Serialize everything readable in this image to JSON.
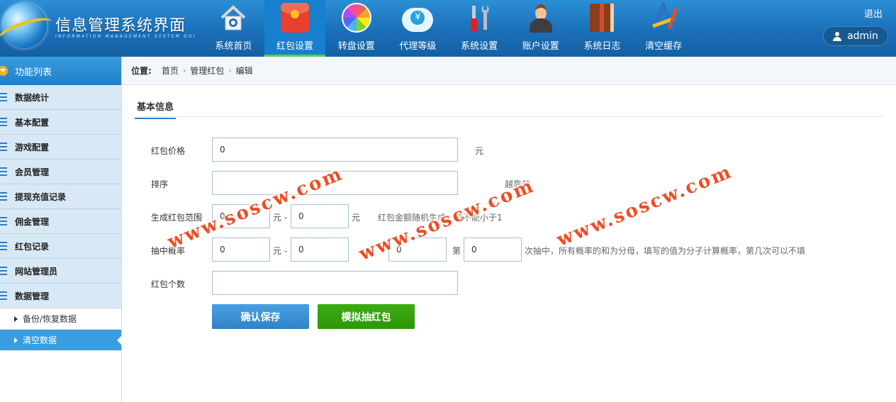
{
  "header": {
    "title": "信息管理系统界面",
    "subtitle": "INFORMATION MANAGEMENT SYSTEM GUI",
    "logout": "退出",
    "user": "admin",
    "nav": [
      {
        "label": "系统首页",
        "icon": "home-icon"
      },
      {
        "label": "红包设置",
        "icon": "red-envelope-icon",
        "active": true
      },
      {
        "label": "转盘设置",
        "icon": "wheel-icon"
      },
      {
        "label": "代理等级",
        "icon": "cloud-money-icon"
      },
      {
        "label": "系统设置",
        "icon": "tools-icon"
      },
      {
        "label": "账户设置",
        "icon": "user-icon"
      },
      {
        "label": "系统日志",
        "icon": "book-icon"
      },
      {
        "label": "清空缓存",
        "icon": "pencil-ruler-icon"
      }
    ]
  },
  "sidebar": {
    "title": "功能列表",
    "items": [
      "数据统计",
      "基本配置",
      "游戏配置",
      "会员管理",
      "提现充值记录",
      "佣金管理",
      "红包记录",
      "网站管理员",
      "数据管理"
    ],
    "subitems": [
      "备份/恢复数据",
      "清空数据"
    ]
  },
  "breadcrumb": {
    "label": "位置:",
    "items": [
      "首页",
      "管理红包",
      "编辑"
    ]
  },
  "form": {
    "section": "基本信息",
    "price_label": "红包价格",
    "price_value": "0",
    "price_unit": "元",
    "sort_label": "排序",
    "sort_value": "",
    "sort_hint": "越靠前",
    "range_label": "生成红包范围",
    "range_min": "0",
    "range_max": "0",
    "range_unit1": "元 -",
    "range_unit2": "元",
    "range_hint": "红包金额随机生成，值不能小于1",
    "draw_label": "抽中概率",
    "draw_min": "0",
    "draw_max": "0",
    "draw_unit": "元 -",
    "draw_num1": "0",
    "draw_di": "第",
    "draw_num2": "0",
    "draw_hint": "次抽中，所有概率的和为分母，填写的值为分子计算概率，第几次可以不填",
    "count_label": "红包个数",
    "count_value": "",
    "save_btn": "确认保存",
    "sim_btn": "模拟抽红包"
  },
  "watermark": "www.soscw.com",
  "colors": {
    "accent": "#2a7fc8",
    "save": "#3a8fd4",
    "simulate": "#34a00c",
    "active_tab_underline": "#5bd04a"
  }
}
